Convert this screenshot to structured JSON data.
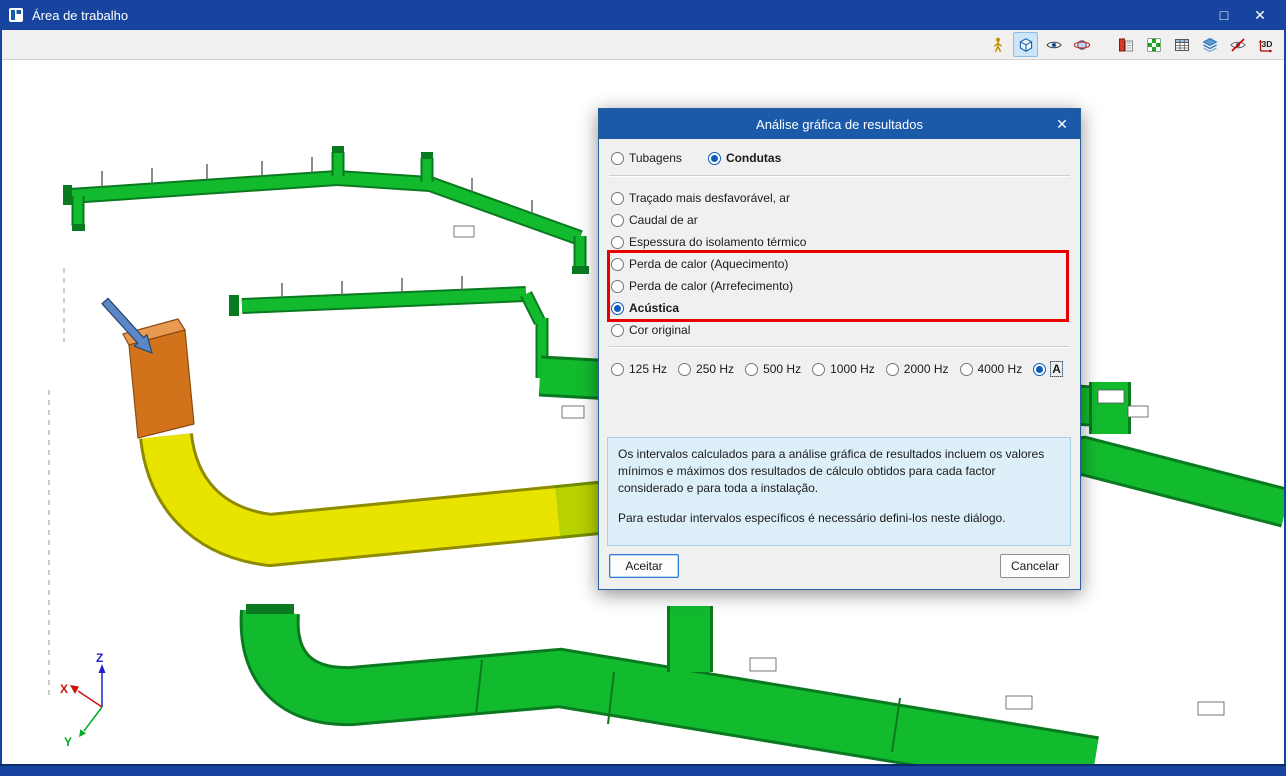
{
  "window": {
    "title": "Área de trabalho",
    "controls": {
      "maximize": "□",
      "close": "✕"
    }
  },
  "toolbar": {
    "icons": [
      {
        "name": "person-icon"
      },
      {
        "name": "view-cube-icon",
        "active": true
      },
      {
        "name": "eye-icon"
      },
      {
        "name": "orbit-icon"
      },
      {
        "name": "section-analysis-icon",
        "group_start": true
      },
      {
        "name": "render-options-icon"
      },
      {
        "name": "table-icon"
      },
      {
        "name": "layers-icon"
      },
      {
        "name": "hide-elements-icon"
      },
      {
        "name": "3d-view-icon"
      }
    ]
  },
  "dialog": {
    "title": "Análise gráfica de resultados",
    "close_label": "✕",
    "type_options": [
      {
        "label": "Tubagens",
        "selected": false
      },
      {
        "label": "Condutas",
        "selected": true
      }
    ],
    "analysis_options": [
      {
        "label": "Traçado mais desfavorável, ar",
        "selected": false
      },
      {
        "label": "Caudal de ar",
        "selected": false
      },
      {
        "label": "Espessura do isolamento térmico",
        "selected": false
      },
      {
        "label": "Perda de calor (Aquecimento)",
        "selected": false
      },
      {
        "label": "Perda de calor (Arrefecimento)",
        "selected": false
      },
      {
        "label": "Acústica",
        "selected": true
      },
      {
        "label": "Cor original",
        "selected": false
      }
    ],
    "frequency_options": [
      {
        "label": "125 Hz",
        "selected": false
      },
      {
        "label": "250 Hz",
        "selected": false
      },
      {
        "label": "500 Hz",
        "selected": false
      },
      {
        "label": "1000 Hz",
        "selected": false
      },
      {
        "label": "2000 Hz",
        "selected": false
      },
      {
        "label": "4000 Hz",
        "selected": false
      },
      {
        "label": "A",
        "selected": true,
        "focused": true
      }
    ],
    "info_paragraphs": [
      "Os intervalos calculados para a análise gráfica de resultados incluem os valores mínimos e máximos dos resultados de cálculo obtidos para cada factor considerado e para toda a instalação.",
      "Para estudar intervalos específicos é necessário defini-los neste diálogo."
    ],
    "accept_label": "Aceitar",
    "cancel_label": "Cancelar"
  },
  "scene": {
    "axis_labels": {
      "x": "X",
      "y": "Y",
      "z": "Z"
    }
  },
  "colors": {
    "titlebar_blue": "#17449e",
    "dialog_title_blue": "#1a5aa8",
    "duct_green": "#12bb2e",
    "duct_yellow": "#e8e400",
    "duct_orange": "#d2731c",
    "annotation_red": "#e80000"
  }
}
